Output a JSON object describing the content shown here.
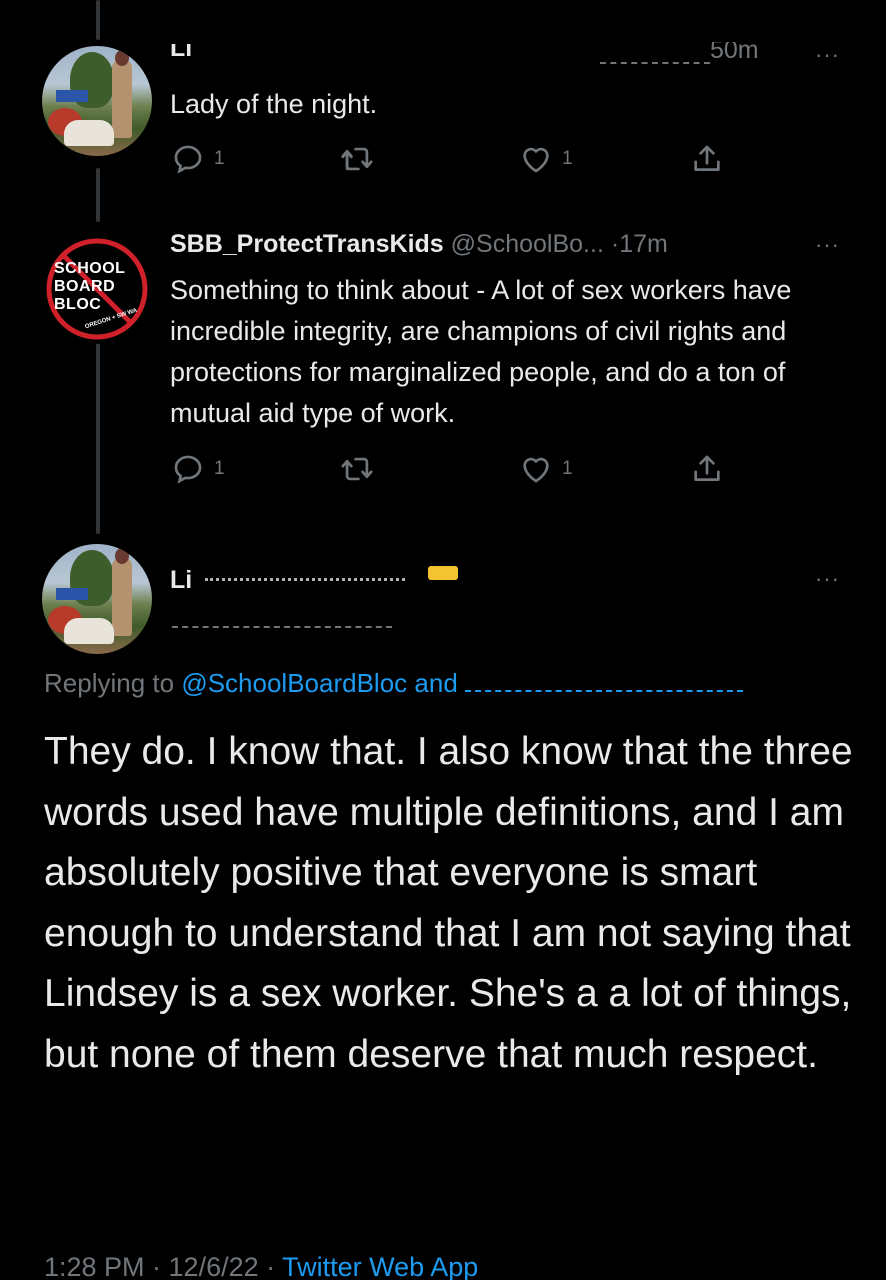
{
  "tweets": [
    {
      "display_name": "Li",
      "time": "50m",
      "text": "Lady of the night.",
      "replies": "1",
      "likes": "1"
    },
    {
      "display_name": "SBB_ProtectTransKids",
      "handle": "@SchoolBo...",
      "separator": "·",
      "time": "17m",
      "text": "Something to think about - A lot of sex workers have incredible integrity, are champions of civil rights and protections for marginalized people, and do a ton of mutual aid type of work.",
      "replies": "1",
      "likes": "1",
      "avatar_logo": {
        "line1": "SCHOOL",
        "line2": "BOARD",
        "line3": "BLOC",
        "sub": "OREGON + SW WA"
      }
    }
  ],
  "main_tweet": {
    "display_name": "Li",
    "replying_prefix": "Replying to",
    "replying_mention": "@SchoolBoardBloc",
    "replying_and": "and",
    "text": "They do. I know that. I also know that the three words used have multiple definitions, and I am absolutely positive that everyone is smart enough to understand that I am not saying that Lindsey is a sex worker. She's a a lot of things, but none of them deserve that much respect.",
    "timestamp": "1:28 PM · 12/6/22 ·",
    "source": "Twitter Web App"
  },
  "more_label": "···",
  "colors": {
    "background": "#000000",
    "text": "#e7e9ea",
    "muted": "#71767b",
    "link": "#1d9bf0",
    "logo_red": "#d0202a"
  }
}
